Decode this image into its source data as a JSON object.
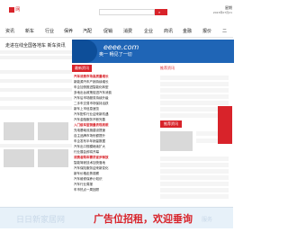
{
  "header": {
    "logo_suffix": "网",
    "date_line1": "星期",
    "date_line2": "2023年07月21"
  },
  "nav": [
    "资讯",
    "新车",
    "行业",
    "保养",
    "汽配",
    "促销",
    "消费",
    "企业",
    "商讯",
    "金融",
    "报价",
    "二"
  ],
  "banner": {
    "brand": "eeee.com",
    "slogan": "奥一 畅见了一切"
  },
  "left": {
    "promo": "走进在线全国各地车 新车资讯"
  },
  "mid": {
    "heading": "最新资讯",
    "items": [
      "汽车消费市场高质量增长",
      "新能源汽车产销持续增长",
      "车企加快推进智能化转型",
      "多地出台政策促进汽车消费",
      "汽车后市场服务持续升级",
      "二手车交易市场保持活跃",
      "新车上市信息速览",
      "汽车配件行业迎来新机遇",
      "汽车金融服务不断完善",
      "入门级车型销量表现亮眼",
      "充电基础设施建设提速",
      "自主品牌市场份额提升",
      "车企发布半年销量数据",
      "汽车出口规模继续扩大",
      "行业展会即将开幕",
      "消费者购车需求逐步释放",
      "智能驾驶技术加快落地",
      "汽车保险服务迎来新变化",
      "新车价格走势观察",
      "汽车维修保养小知识",
      "汽车行业周报",
      "车市热点一周回顾"
    ]
  },
  "right": {
    "heading1": "推荐资讯",
    "heading2": "推荐资讯"
  },
  "ad": {
    "left": "日日新家居网",
    "main": "广告位招租，欢迎垂询",
    "right": "服务"
  },
  "colors": {
    "brand_red": "#d8232a",
    "banner_blue": "#1f65b6"
  }
}
